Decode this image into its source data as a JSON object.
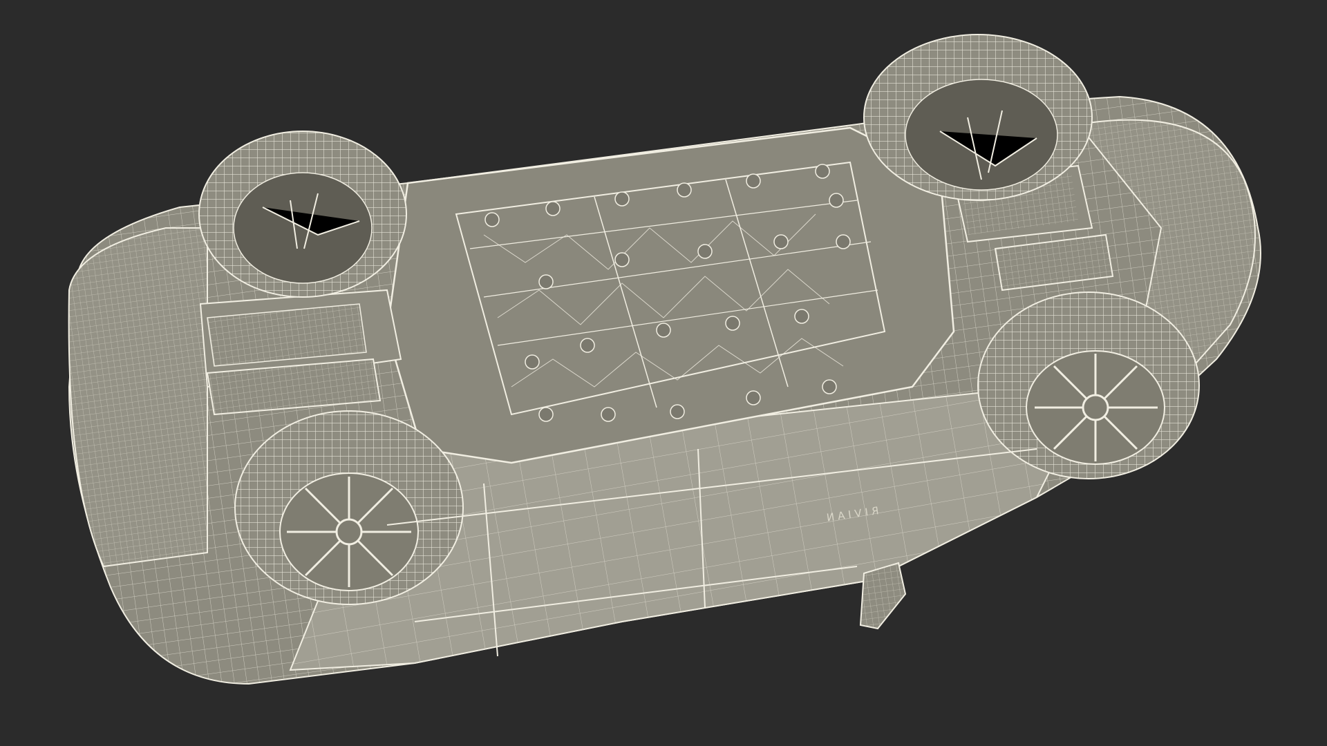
{
  "scene": {
    "background_color": "#2b2b2b",
    "model_surface_color": "#8d8b7f",
    "wireframe_color": "#f1eee2",
    "shadow_color": "#5f5d54"
  },
  "branding": {
    "vehicle_badge": "RIVIAN"
  }
}
